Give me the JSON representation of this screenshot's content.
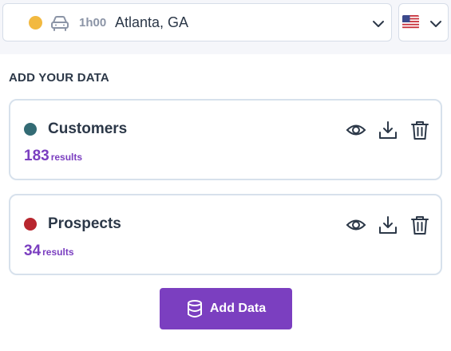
{
  "trip": {
    "duration": "1h00",
    "location": "Atlanta, GA",
    "status_color": "#f2b940",
    "mode_icon": "car-icon"
  },
  "country": {
    "flag_icon": "us-flag-icon"
  },
  "section_title": "ADD YOUR DATA",
  "datasets": [
    {
      "name": "Customers",
      "count": "183",
      "count_label": "results",
      "color": "#336b74"
    },
    {
      "name": "Prospects",
      "count": "34",
      "count_label": "results",
      "color": "#b8262e"
    }
  ],
  "actions": {
    "view_icon": "eye-icon",
    "download_icon": "download-icon",
    "delete_icon": "trash-icon"
  },
  "add_button": {
    "label": "Add Data",
    "icon": "database-icon"
  },
  "colors": {
    "accent": "#7b3fc0",
    "text": "#2c3848",
    "border": "#d7e1ec"
  }
}
